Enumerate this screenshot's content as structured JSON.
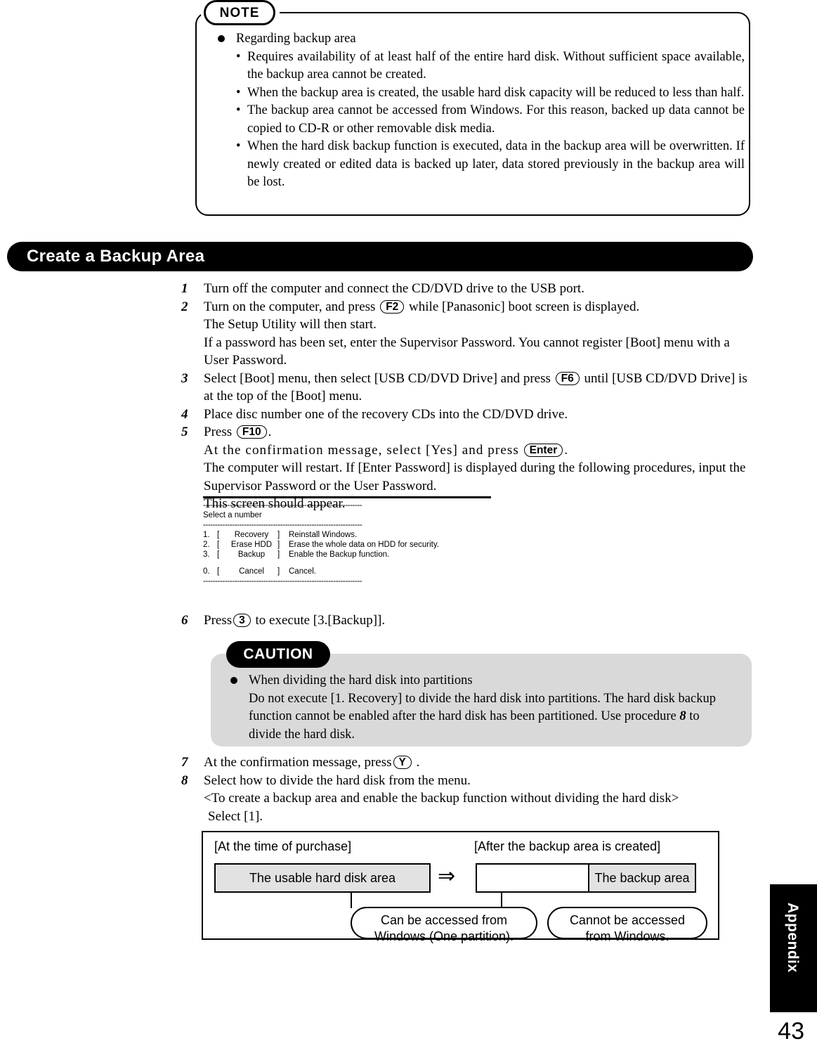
{
  "note": {
    "tab_label": "NOTE",
    "heading": "Regarding backup area",
    "items": [
      "Requires availability of at least half of the entire hard disk.  Without sufficient space available, the backup area cannot be created.",
      "When the backup area is created, the usable hard disk capacity will be reduced to less than half.",
      "The backup area cannot be accessed from Windows.  For this reason, backed up data cannot be copied to CD-R or other removable disk media.",
      "When the hard disk backup function is executed, data in the backup area will be overwritten.  If newly created or edited data is backed up later, data stored previously in the backup area will be lost."
    ]
  },
  "section": {
    "title": "Create a Backup Area"
  },
  "steps": {
    "s1": {
      "num": "1",
      "text": "Turn off the computer and connect the CD/DVD drive to the USB port."
    },
    "s2": {
      "num": "2",
      "lead": "Turn on the computer, and press",
      "key": "F2",
      "tail": "while [Panasonic] boot screen is displayed.",
      "line2": "The Setup Utility will then start.",
      "line3": "If a password has been set, enter the Supervisor Password. You cannot register [Boot] menu with a User Password."
    },
    "s3": {
      "num": "3",
      "lead": "Select [Boot] menu, then select [USB CD/DVD Drive] and press",
      "key": "F6",
      "tail": "until [USB CD/DVD Drive] is at the top of the [Boot] menu."
    },
    "s4": {
      "num": "4",
      "text": "Place disc number one of the recovery CDs into the CD/DVD drive."
    },
    "s5": {
      "num": "5",
      "lead": "Press",
      "key": "F10",
      "tail": ".",
      "line2_lead": "At the confirmation message, select [Yes] and press",
      "line2_key": "Enter",
      "line2_tail": ".",
      "line3": "The computer will restart. If [Enter Password] is displayed during the following procedures, input the Supervisor Password or the User Password.",
      "line4": "This screen should appear."
    },
    "s6": {
      "num": "6",
      "lead": "Press",
      "key": "3",
      "tail": "to execute [3.[Backup]]."
    },
    "s7": {
      "num": "7",
      "lead": "At the confirmation message, press",
      "key": "Y",
      "tail": "."
    },
    "s8": {
      "num": "8",
      "line1": "Select how to divide the hard disk from the menu.",
      "line2": "<To create a backup area and enable the backup function without dividing the hard disk>",
      "line3": "Select [1]."
    }
  },
  "screen": {
    "rule": "------------------------------------------------------------------",
    "title": "Select a number",
    "rows": [
      {
        "num": "1.",
        "open": "[",
        "name": "Recovery",
        "close": "]",
        "desc": "Reinstall Windows."
      },
      {
        "num": "2.",
        "open": "[",
        "name": "Erase HDD",
        "close": "]",
        "desc": "Erase the whole data on HDD for security."
      },
      {
        "num": "3.",
        "open": "[",
        "name": "Backup",
        "close": "]",
        "desc": "Enable the Backup function."
      }
    ],
    "cancel_row": {
      "num": "0.",
      "open": "[",
      "name": "Cancel",
      "close": "]",
      "desc": "Cancel."
    }
  },
  "caution": {
    "tab_label": "CAUTION",
    "heading": "When dividing the hard disk into partitions",
    "body_a": "Do not execute [1. Recovery] to divide the hard disk into partitions.  The hard disk backup",
    "body_b": "function cannot be enabled after the hard disk has been partitioned.  Use procedure",
    "body_ref": "8",
    "body_c": "to",
    "body_d": "divide the hard disk."
  },
  "diagram": {
    "left_label": "[At the time of purchase]",
    "right_label": "[After the backup area is created]",
    "left_bar": "The usable hard disk area",
    "right_bar_left": "",
    "right_bar_right": "The backup area",
    "arrow": "⇒",
    "left_oval_l1": "Can be accessed from",
    "left_oval_l2": "Windows (One partition).",
    "right_oval_l1": "Cannot be accessed",
    "right_oval_l2": "from Windows."
  },
  "footer": {
    "tab_label": "Appendix",
    "page_number": "43"
  }
}
